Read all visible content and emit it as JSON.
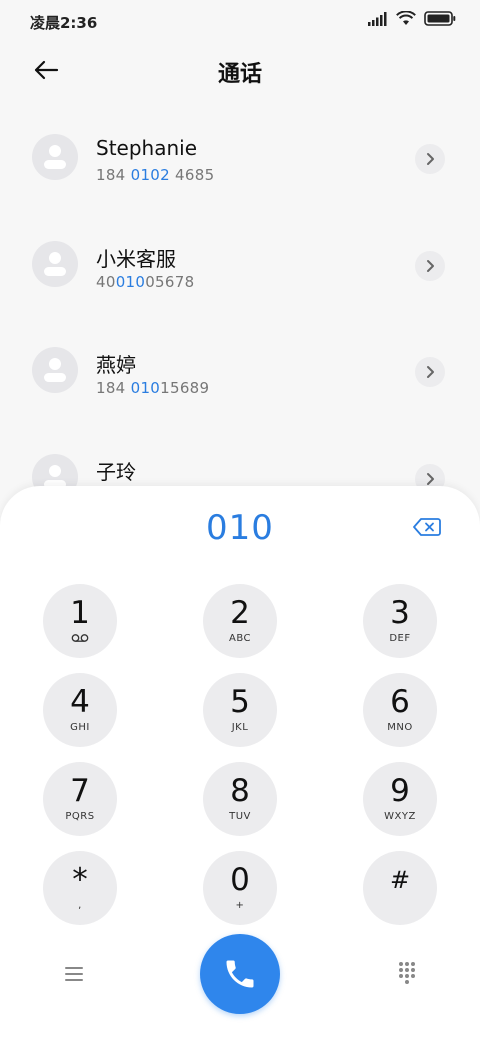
{
  "status": {
    "time": "凌晨2:36"
  },
  "header": {
    "title": "通话"
  },
  "contacts": [
    {
      "name": "Stephanie",
      "number": [
        "184 ",
        "0102",
        " 4685"
      ]
    },
    {
      "name": "小米客服",
      "number": [
        "40",
        "010",
        "05678"
      ]
    },
    {
      "name": "燕婷",
      "number": [
        "184 ",
        "010",
        "15689"
      ]
    },
    {
      "name": "子玲",
      "number": [
        "",
        "",
        ""
      ]
    }
  ],
  "dialer": {
    "entered": "010",
    "keys": [
      {
        "digit": "1",
        "letters": "voicemail-icon"
      },
      {
        "digit": "2",
        "letters": "ABC"
      },
      {
        "digit": "3",
        "letters": "DEF"
      },
      {
        "digit": "4",
        "letters": "GHI"
      },
      {
        "digit": "5",
        "letters": "JKL"
      },
      {
        "digit": "6",
        "letters": "MNO"
      },
      {
        "digit": "7",
        "letters": "PQRS"
      },
      {
        "digit": "8",
        "letters": "TUV"
      },
      {
        "digit": "9",
        "letters": "WXYZ"
      },
      {
        "digit": "*",
        "letters": ","
      },
      {
        "digit": "0",
        "letters": "+"
      },
      {
        "digit": "#",
        "letters": ""
      }
    ]
  },
  "colors": {
    "accent": "#2a7de0",
    "call": "#2f86ec",
    "keyBg": "#ececee",
    "avatarBg": "#e6e6e9"
  }
}
